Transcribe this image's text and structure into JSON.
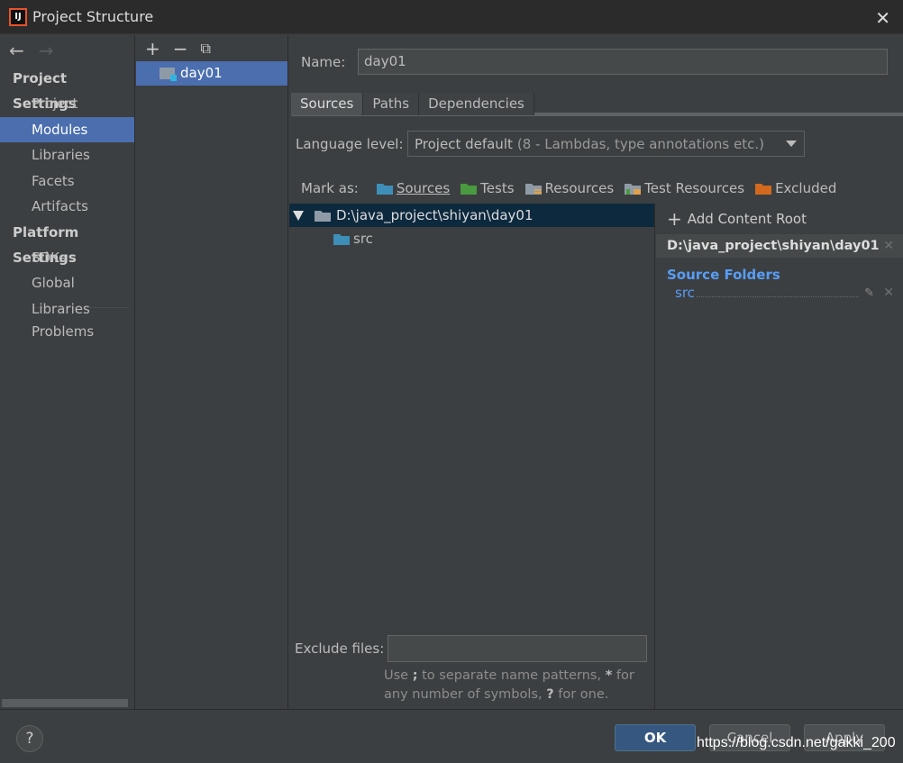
{
  "window": {
    "title": "Project Structure",
    "icon_text": "IJ"
  },
  "leftnav": {
    "groups": [
      {
        "label": "Project Settings",
        "items": [
          "Project",
          "Modules",
          "Libraries",
          "Facets",
          "Artifacts"
        ]
      },
      {
        "label": "Platform Settings",
        "items": [
          "SDKs",
          "Global Libraries"
        ]
      }
    ],
    "extra": "Problems",
    "selected": "Modules"
  },
  "modules": {
    "items": [
      "day01"
    ]
  },
  "main": {
    "name_label": "Name:",
    "name_value": "day01",
    "tabs": [
      "Sources",
      "Paths",
      "Dependencies"
    ],
    "active_tab": "Sources",
    "language_level_label": "Language level:",
    "language_level_value": "Project default",
    "language_level_detail": "(8 - Lambdas, type annotations etc.)",
    "mark_as_label": "Mark as:",
    "mark_as": [
      {
        "label": "Sources",
        "color": "#3d8fb8"
      },
      {
        "label": "Tests",
        "color": "#4a9a3f"
      },
      {
        "label": "Resources",
        "color": "#8e9ba7"
      },
      {
        "label": "Test Resources",
        "color": "#8e9ba7"
      },
      {
        "label": "Excluded",
        "color": "#d2691e"
      }
    ],
    "tree": {
      "root": "D:\\java_project\\shiyan\\day01",
      "child": "src"
    },
    "exclude_label": "Exclude files:",
    "exclude_value": "",
    "exclude_hint_1a": "Use ",
    "exclude_hint_1b": ";",
    "exclude_hint_1c": " to separate name patterns, ",
    "exclude_hint_1d": "*",
    "exclude_hint_1e": " for",
    "exclude_hint_2a": "any number of symbols, ",
    "exclude_hint_2b": "?",
    "exclude_hint_2c": " for one."
  },
  "roots": {
    "add_label": "Add Content Root",
    "root_path": "D:\\java_project\\shiyan\\day01",
    "source_folders_title": "Source Folders",
    "source_folders": [
      "src"
    ]
  },
  "footer": {
    "help": "?",
    "ok": "OK",
    "cancel": "Cancel",
    "apply": "Apply",
    "watermark": "https://blog.csdn.net/gakki_200"
  },
  "colors": {
    "accent": "#4b6eaf",
    "ok_button": "#365880",
    "source_folder_text": "#589df6"
  }
}
